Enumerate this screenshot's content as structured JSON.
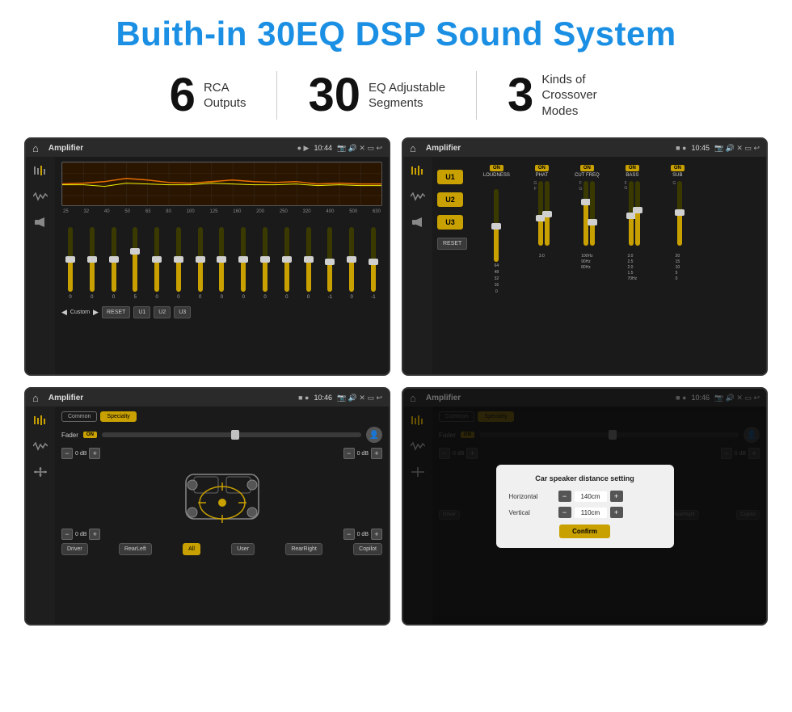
{
  "title": "Buith-in 30EQ DSP Sound System",
  "stats": [
    {
      "number": "6",
      "label_line1": "RCA",
      "label_line2": "Outputs"
    },
    {
      "number": "30",
      "label_line1": "EQ Adjustable",
      "label_line2": "Segments"
    },
    {
      "number": "3",
      "label_line1": "Kinds of",
      "label_line2": "Crossover Modes"
    }
  ],
  "screens": [
    {
      "id": "eq-screen",
      "status_bar": {
        "title": "Amplifier",
        "time": "10:44"
      },
      "type": "eq"
    },
    {
      "id": "crossover-screen",
      "status_bar": {
        "title": "Amplifier",
        "time": "10:45"
      },
      "type": "crossover"
    },
    {
      "id": "fader-screen",
      "status_bar": {
        "title": "Amplifier",
        "time": "10:46"
      },
      "type": "fader"
    },
    {
      "id": "dialog-screen",
      "status_bar": {
        "title": "Amplifier",
        "time": "10:46"
      },
      "type": "dialog"
    }
  ],
  "eq": {
    "frequencies": [
      "25",
      "32",
      "40",
      "50",
      "63",
      "80",
      "100",
      "125",
      "160",
      "200",
      "250",
      "320",
      "400",
      "500",
      "630"
    ],
    "values": [
      "0",
      "0",
      "0",
      "5",
      "0",
      "0",
      "0",
      "0",
      "0",
      "0",
      "0",
      "0",
      "-1",
      "0",
      "-1"
    ],
    "preset": "Custom",
    "buttons": [
      "RESET",
      "U1",
      "U2",
      "U3"
    ]
  },
  "crossover": {
    "u_buttons": [
      "U1",
      "U2",
      "U3"
    ],
    "channels": [
      "LOUDNESS",
      "PHAT",
      "CUT FREQ",
      "BASS",
      "SUB"
    ],
    "on_labels": [
      "ON",
      "ON",
      "ON",
      "ON",
      "ON"
    ]
  },
  "fader": {
    "tabs": [
      "Common",
      "Specialty"
    ],
    "active_tab": "Specialty",
    "fader_label": "Fader",
    "on_label": "ON",
    "positions": [
      "0 dB",
      "0 dB",
      "0 dB",
      "0 dB"
    ],
    "bottom_buttons": [
      "Driver",
      "RearLeft",
      "All",
      "User",
      "RearRight",
      "Copilot"
    ]
  },
  "dialog": {
    "title": "Car speaker distance setting",
    "horizontal_label": "Horizontal",
    "horizontal_value": "140cm",
    "vertical_label": "Vertical",
    "vertical_value": "110cm",
    "confirm_label": "Confirm"
  }
}
